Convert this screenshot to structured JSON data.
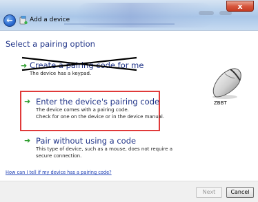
{
  "window": {
    "title": "Add a device",
    "close_glyph": "x"
  },
  "page": {
    "heading": "Select a pairing option"
  },
  "options": [
    {
      "title": "Create a pairing code for me",
      "desc": [
        "The device has a keypad."
      ],
      "crossed_out": true
    },
    {
      "title": "Enter the device's pairing code",
      "desc": [
        "The device comes with a pairing code.",
        "Check for one on the device or in the device manual."
      ],
      "highlighted": true
    },
    {
      "title": "Pair without using a code",
      "desc": [
        "This type of device, such as a mouse, does not require a",
        "secure connection."
      ]
    }
  ],
  "device": {
    "name": "ZBBT",
    "icon": "mouse-icon"
  },
  "help_link": "How can I tell if my device has a pairing code?",
  "buttons": {
    "next": "Next",
    "cancel": "Cancel"
  },
  "colors": {
    "heading": "#1e3287",
    "highlight_border": "#e03a3a",
    "arrow": "#2f9e2f",
    "link": "#1d3fb5"
  }
}
